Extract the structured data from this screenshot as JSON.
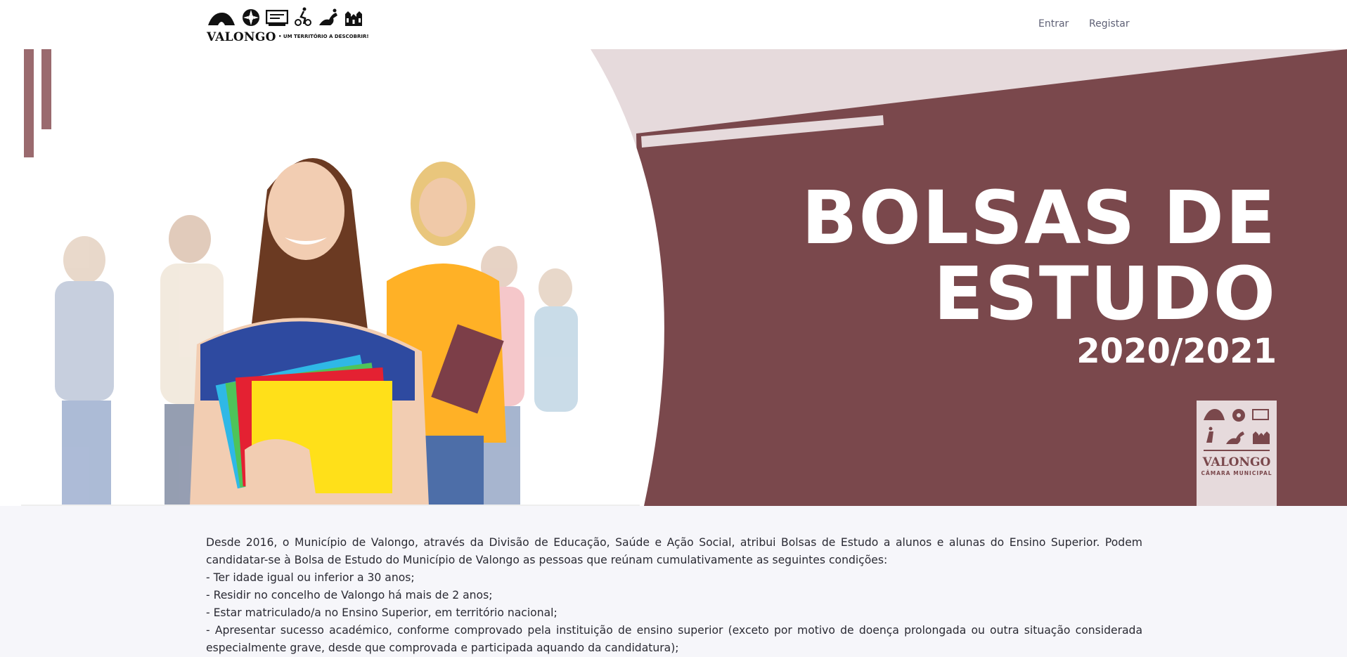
{
  "header": {
    "logo": {
      "wordmark": "VALONGO",
      "tagline": "• UM TERRITÓRIO A DESCOBRIR!",
      "icons": [
        "tent-icon",
        "flower-icon",
        "screen-icon",
        "cyclist-icon",
        "horse-icon",
        "church-icon"
      ]
    },
    "nav": {
      "entrar": "Entrar",
      "registar": "Registar"
    }
  },
  "hero": {
    "title_line1": "BOLSAS DE",
    "title_line2": "ESTUDO",
    "year": "2020/2021",
    "stamp": {
      "wordmark": "VALONGO",
      "subtitle": "CÂMARA MUNICIPAL"
    },
    "colors": {
      "brand": "#7a484c",
      "light_brand": "#e6dadc"
    }
  },
  "content": {
    "intro": "Desde 2016, o Município de Valongo, através da Divisão de Educação, Saúde e Ação Social, atribui Bolsas de Estudo a alunos e alunas do Ensino Superior. Podem candidatar-se à Bolsa de Estudo do Município de Valongo as pessoas que reúnam cumulativamente as seguintes condições:",
    "conditions": [
      "- Ter idade igual ou inferior a 30 anos;",
      "- Residir no concelho de Valongo há mais de 2 anos;",
      "- Estar matriculado/a no Ensino Superior, em território nacional;",
      "- Apresentar sucesso académico, conforme comprovado pela instituição de ensino superior (exceto por motivo de doença prolongada ou outra situação considerada especialmente grave, desde que comprovada e participada aquando da candidatura);"
    ]
  }
}
